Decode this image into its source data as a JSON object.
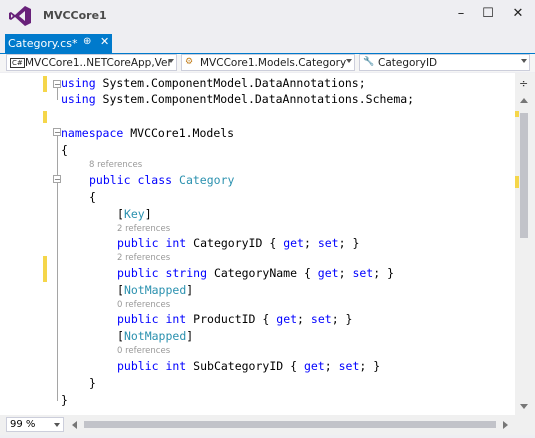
{
  "window": {
    "title": "MVCCore1",
    "buttons": [
      "–",
      "☐",
      "✕"
    ]
  },
  "tab": {
    "label": "Category.cs*",
    "pin": "⊕",
    "close": "✕"
  },
  "nav": {
    "project": "MVCCore1..NETCoreApp,Ver",
    "class": "MVCCore1.Models.Category",
    "member": "CategoryID"
  },
  "code": {
    "l1_using": "using",
    "l1_rest": " System.ComponentModel.DataAnnotations;",
    "l2_using": "using",
    "l2_rest": " System.ComponentModel.DataAnnotations.Schema;",
    "ns_kw": "namespace",
    "ns_name": " MVCCore1.Models",
    "brace_open": "{",
    "refs_class": "8 references",
    "class_kw": "public class",
    "class_name": "Category",
    "brace_open2": "{",
    "attr_key": "Key",
    "refs_p1": "2 references",
    "p1_kw": "public int",
    "p1_rest": " CategoryID { ",
    "p1_get": "get",
    "p1_mid": "; ",
    "p1_set": "set",
    "p1_end": "; }",
    "refs_p2": "2 references",
    "p2_kw": "public string",
    "p2_rest": " CategoryName { ",
    "p2_get": "get",
    "p2_mid": "; ",
    "p2_set": "set",
    "p2_end": "; }",
    "attr_nm1": "NotMapped",
    "refs_p3": "0 references",
    "p3_kw": "public int",
    "p3_rest": " ProductID { ",
    "p3_get": "get",
    "p3_mid": "; ",
    "p3_set": "set",
    "p3_end": "; }",
    "attr_nm2": "NotMapped",
    "refs_p4": "0 references",
    "p4_kw": "public int",
    "p4_rest": " SubCategoryID { ",
    "p4_get": "get",
    "p4_mid": "; ",
    "p4_set": "set",
    "p4_end": "; }",
    "brace_close2": "}",
    "brace_close": "}"
  },
  "status": {
    "zoom": "99 %"
  },
  "colors": {
    "accent": "#007acc",
    "keyword": "#0000ff",
    "type": "#2b91af",
    "modified": "#f5d64a"
  }
}
